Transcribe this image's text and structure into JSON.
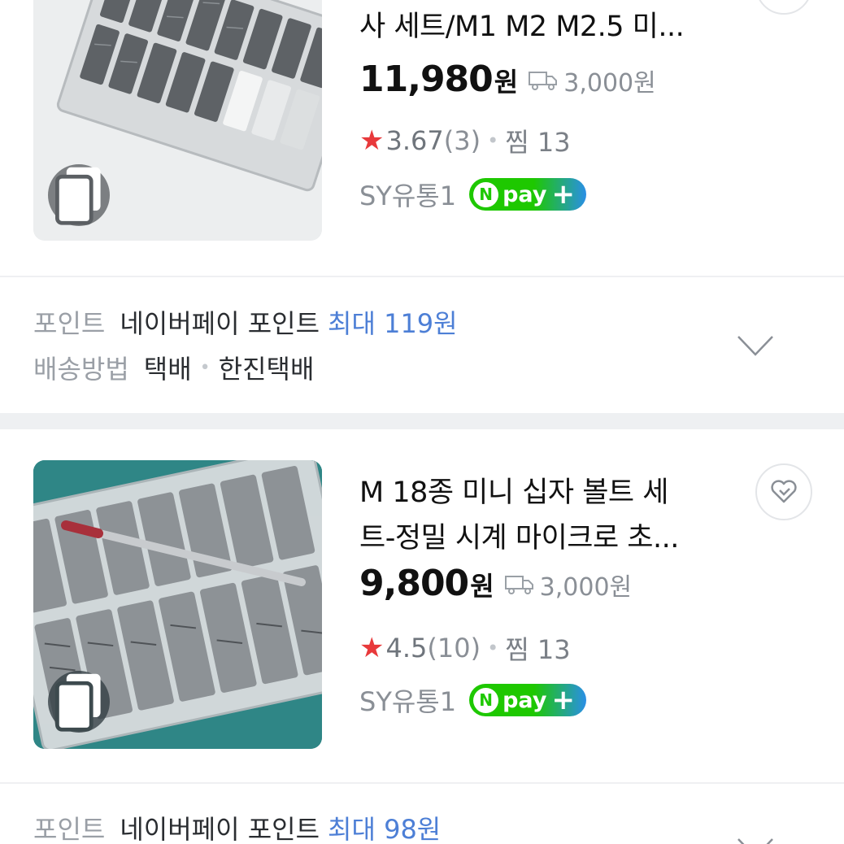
{
  "products": [
    {
      "title_lines": [
        "사 세트/M1 M2 M2.5 미..."
      ],
      "price": "11,980",
      "price_unit": "원",
      "shipping_fee": "3,000원",
      "rating": "3.67",
      "review_count": "(3)",
      "zzim": "찜 13",
      "seller": "SY유통1",
      "npay": {
        "n": "N",
        "text": "pay",
        "plus": "+"
      },
      "icons": {
        "multi_image": "copy-icon",
        "shipping": "truck-icon",
        "wish": "heart-icon"
      }
    },
    {
      "title_lines": [
        "M 18종 미니 십자 볼트 세",
        "트-정밀 시계 마이크로 초..."
      ],
      "price": "9,800",
      "price_unit": "원",
      "shipping_fee": "3,000원",
      "rating": "4.5",
      "review_count": "(10)",
      "zzim": "찜 13",
      "seller": "SY유통1",
      "npay": {
        "n": "N",
        "text": "pay",
        "plus": "+"
      },
      "icons": {
        "multi_image": "copy-icon",
        "shipping": "truck-icon",
        "wish": "heart-icon"
      }
    }
  ],
  "info_blocks": [
    {
      "point_label": "포인트",
      "point_value": "네이버페이 포인트",
      "point_max": "최대 119원",
      "delivery_label": "배송방법",
      "delivery_type": "택배",
      "delivery_carrier": "한진택배",
      "expand_icon": "chevron-down-icon"
    },
    {
      "point_label": "포인트",
      "point_value": "네이버페이 포인트",
      "point_max": "최대 98원",
      "expand_icon": "chevron-down-icon"
    }
  ],
  "colors": {
    "star": "#e8393b",
    "highlight": "#4d7fd6",
    "npay_green": "#1ec800",
    "npay_blue": "#2a8fe6",
    "muted": "#8a8f96"
  }
}
